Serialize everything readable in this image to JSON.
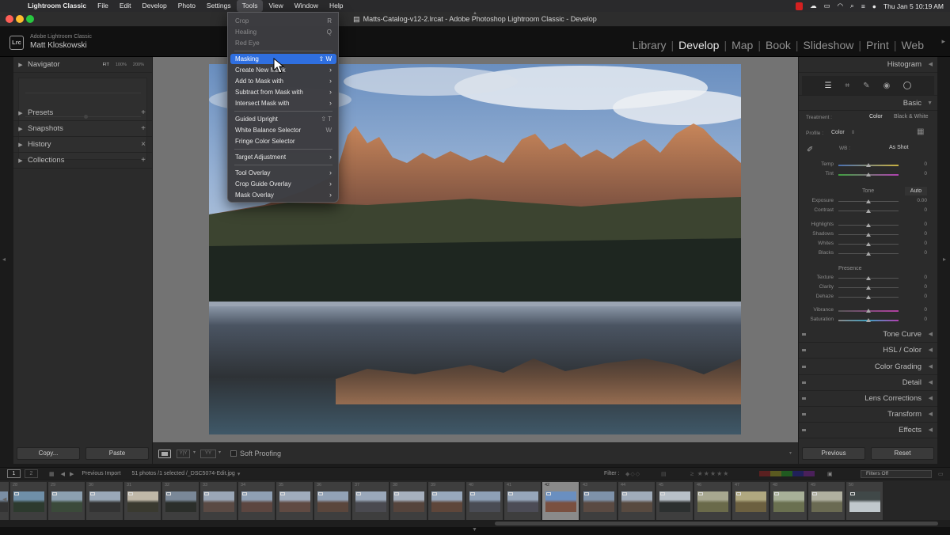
{
  "menubar": {
    "app": "Lightroom Classic",
    "items": [
      "File",
      "Edit",
      "Develop",
      "Photo",
      "Settings",
      "Tools",
      "View",
      "Window",
      "Help"
    ],
    "active": "Tools",
    "datetime": "Thu Jan 5  10:19 AM"
  },
  "window": {
    "title": "Matts-Catalog-v12-2.lrcat - Adobe Photoshop Lightroom Classic - Develop"
  },
  "identity": {
    "logo": "Lrc",
    "app_name": "Adobe Lightroom Classic",
    "user": "Matt Kloskowski"
  },
  "modules": [
    {
      "label": "Library",
      "active": false
    },
    {
      "label": "Develop",
      "active": true
    },
    {
      "label": "Map",
      "active": false
    },
    {
      "label": "Book",
      "active": false
    },
    {
      "label": "Slideshow",
      "active": false
    },
    {
      "label": "Print",
      "active": false
    },
    {
      "label": "Web",
      "active": false
    }
  ],
  "left_panel": {
    "navigator": {
      "title": "Navigator",
      "zoom": [
        "FIT",
        "100%",
        "200%"
      ]
    },
    "panels": [
      {
        "title": "Presets",
        "action": "+"
      },
      {
        "title": "Snapshots",
        "action": "+"
      },
      {
        "title": "History",
        "action": "×"
      },
      {
        "title": "Collections",
        "action": "+"
      }
    ],
    "copy_label": "Copy...",
    "paste_label": "Paste"
  },
  "tools_menu": {
    "items": [
      {
        "label": "Crop",
        "shortcut": "R",
        "disabled": true
      },
      {
        "label": "Healing",
        "shortcut": "Q",
        "disabled": true
      },
      {
        "label": "Red Eye",
        "shortcut": "",
        "disabled": true
      },
      {
        "label": "Masking",
        "shortcut": "⇧ W",
        "highlighted": true
      },
      {
        "label": "Create New Mask",
        "submenu": true
      },
      {
        "label": "Add to Mask with",
        "submenu": true
      },
      {
        "label": "Subtract from Mask with",
        "submenu": true
      },
      {
        "label": "Intersect Mask with",
        "submenu": true
      },
      {
        "label": "Guided Upright",
        "shortcut": "⇧ T"
      },
      {
        "label": "White Balance Selector",
        "shortcut": "W"
      },
      {
        "label": "Fringe Color Selector",
        "shortcut": ""
      },
      {
        "label": "Target Adjustment",
        "submenu": true
      },
      {
        "label": "Tool Overlay",
        "submenu": true
      },
      {
        "label": "Crop Guide Overlay",
        "submenu": true
      },
      {
        "label": "Mask Overlay",
        "submenu": true
      }
    ]
  },
  "toolbar": {
    "soft_proofing": "Soft Proofing"
  },
  "right_panel": {
    "histogram": "Histogram",
    "basic": {
      "title": "Basic",
      "treatment_label": "Treatment :",
      "treatment_color": "Color",
      "treatment_bw": "Black & White",
      "profile_label": "Profile :",
      "profile_value": "Color",
      "wb_label": "WB :",
      "wb_value": "As Shot",
      "tone_label": "Tone",
      "auto_label": "Auto",
      "presence_label": "Presence",
      "sliders": [
        {
          "label": "Temp",
          "value": "0",
          "pos": 0.5
        },
        {
          "label": "Tint",
          "value": "0",
          "pos": 0.5
        },
        {
          "label": "Exposure",
          "value": "0.00",
          "pos": 0.5
        },
        {
          "label": "Contrast",
          "value": "0",
          "pos": 0.5
        },
        {
          "label": "Highlights",
          "value": "0",
          "pos": 0.5
        },
        {
          "label": "Shadows",
          "value": "0",
          "pos": 0.5
        },
        {
          "label": "Whites",
          "value": "0",
          "pos": 0.5
        },
        {
          "label": "Blacks",
          "value": "0",
          "pos": 0.5
        },
        {
          "label": "Texture",
          "value": "0",
          "pos": 0.5
        },
        {
          "label": "Clarity",
          "value": "0",
          "pos": 0.5
        },
        {
          "label": "Dehaze",
          "value": "0",
          "pos": 0.5
        },
        {
          "label": "Vibrance",
          "value": "0",
          "pos": 0.5
        },
        {
          "label": "Saturation",
          "value": "0",
          "pos": 0.5
        }
      ]
    },
    "collapsed_panels": [
      "Tone Curve",
      "HSL / Color",
      "Color Grading",
      "Detail",
      "Lens Corrections",
      "Transform",
      "Effects"
    ],
    "previous_label": "Previous",
    "reset_label": "Reset"
  },
  "filmstrip_bar": {
    "screen1": "1",
    "screen2": "2",
    "source": "Previous Import",
    "info": "51 photos /1 selected /_DSC5074-Edit.jpg",
    "filter_label": "Filter :",
    "filters_off": "Filters Off"
  },
  "filmstrip": {
    "selected": "42",
    "frames": [
      "28",
      "29",
      "30",
      "31",
      "32",
      "33",
      "34",
      "35",
      "36",
      "37",
      "38",
      "39",
      "40",
      "41",
      "42",
      "43",
      "44",
      "45",
      "46",
      "47",
      "48",
      "49",
      "50"
    ]
  },
  "colors": {
    "highlight": "#2f6fe0",
    "panel_bg": "#2b2b2b",
    "canvas_bg": "#737373"
  }
}
